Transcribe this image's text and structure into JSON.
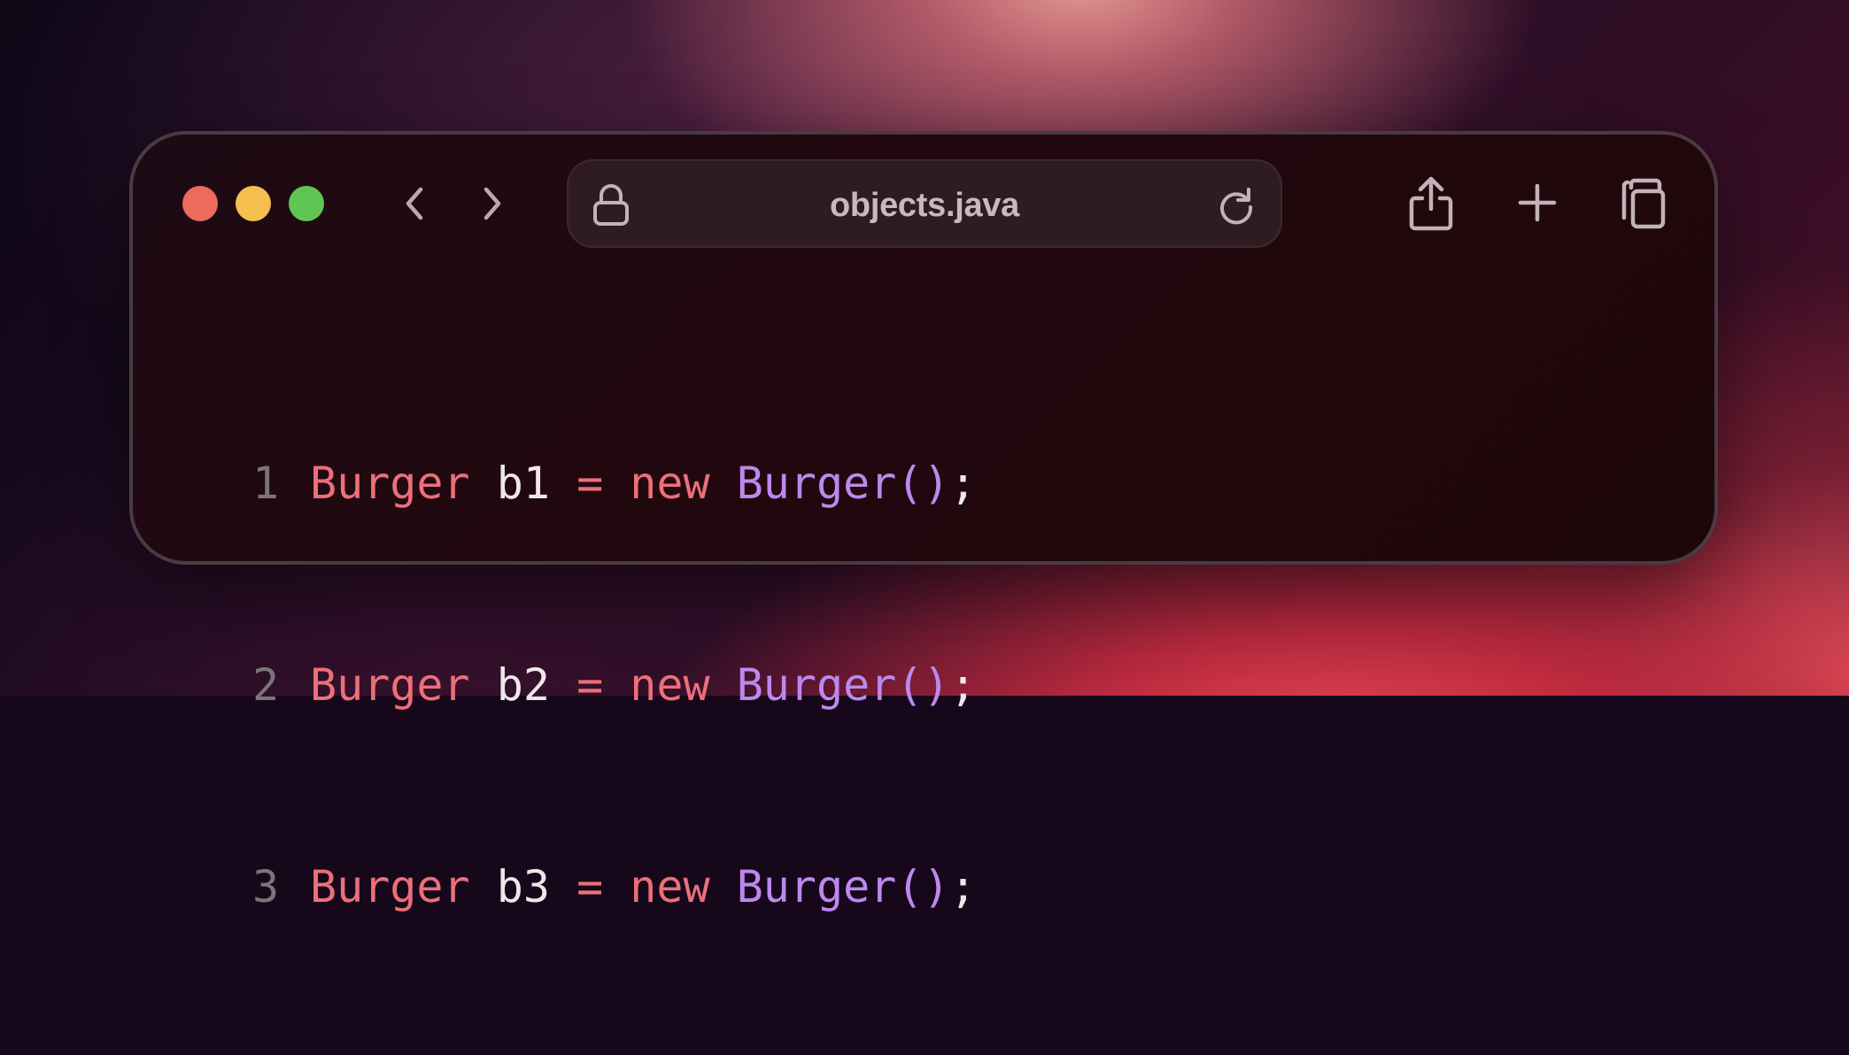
{
  "window": {
    "url": "objects.java",
    "traffic_lights": [
      "close",
      "minimize",
      "zoom"
    ],
    "icons": {
      "back": "chevron-left-icon",
      "forward": "chevron-right-icon",
      "lock": "lock-icon",
      "reload": "reload-icon",
      "share": "share-icon",
      "add": "plus-icon",
      "tabs": "copy-tabs-icon"
    }
  },
  "code": {
    "language": "java",
    "lines": [
      {
        "number": "1",
        "type": "Burger",
        "var": "b1",
        "op": "=",
        "kw": "new",
        "call": "Burger",
        "parens": "()",
        "end": ";"
      },
      {
        "number": "2",
        "type": "Burger",
        "var": "b2",
        "op": "=",
        "kw": "new",
        "call": "Burger",
        "parens": "()",
        "end": ";"
      },
      {
        "number": "3",
        "type": "Burger",
        "var": "b3",
        "op": "=",
        "kw": "new",
        "call": "Burger",
        "parens": "()",
        "end": ";"
      }
    ]
  },
  "colors": {
    "keyword": "#ec6f7a",
    "call": "#bd88ee",
    "identifier": "#efe6ea",
    "line_number": "#7c7479",
    "close": "#ec6a5e",
    "minimize": "#f4bf4f",
    "zoom": "#61c554"
  }
}
